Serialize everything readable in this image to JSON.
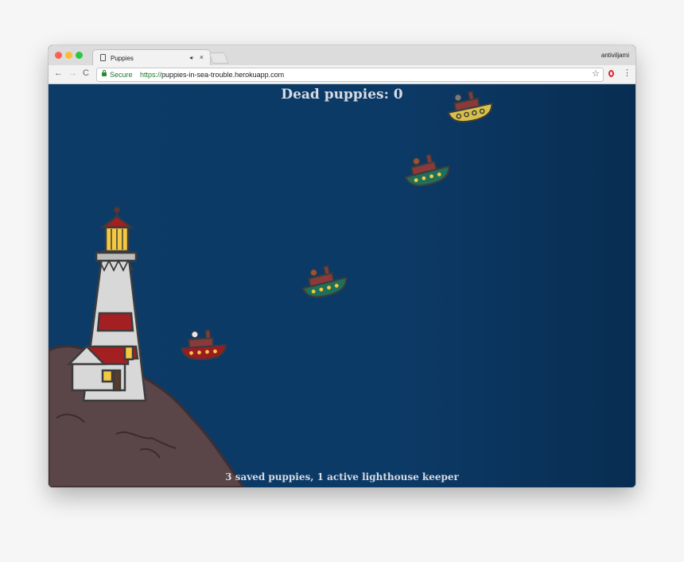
{
  "browser": {
    "tab_title": "Puppies",
    "tab_audio_icon": "speaker-icon",
    "tab_close": "×",
    "profile_name": "antiviljami",
    "secure_label": "Secure",
    "url_scheme": "https://",
    "url_rest": "puppies-in-sea-trouble.herokuapp.com",
    "back": "←",
    "forward": "→",
    "reload": "C",
    "bookmark": "☆",
    "menu": "⋮"
  },
  "game": {
    "dead_puppies_text": "Dead puppies: 0",
    "status_text": "3 saved puppies, 1 active lighthouse keeper",
    "dead_puppies": 0,
    "saved_puppies": 3,
    "active_keepers": 1,
    "boats": [
      {
        "id": "boat-yellow",
        "hull_color": "#d8c14a"
      },
      {
        "id": "boat-green-1",
        "hull_color": "#1f6f5a"
      },
      {
        "id": "boat-green-2",
        "hull_color": "#1f6f5a"
      },
      {
        "id": "boat-red",
        "hull_color": "#9b1b22"
      }
    ],
    "colors": {
      "sea": "#0c3a66",
      "rock": "#5a4548",
      "lighthouse_stripe": "#a31f22",
      "lamp": "#f5c842"
    }
  }
}
